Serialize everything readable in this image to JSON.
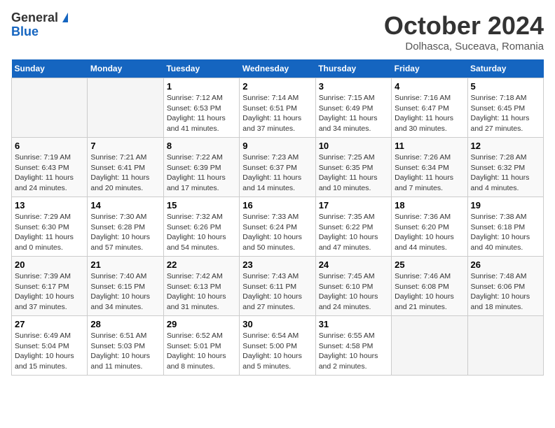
{
  "header": {
    "logo_general": "General",
    "logo_blue": "Blue",
    "month": "October 2024",
    "location": "Dolhasca, Suceava, Romania"
  },
  "weekdays": [
    "Sunday",
    "Monday",
    "Tuesday",
    "Wednesday",
    "Thursday",
    "Friday",
    "Saturday"
  ],
  "weeks": [
    [
      {
        "day": "",
        "detail": ""
      },
      {
        "day": "",
        "detail": ""
      },
      {
        "day": "1",
        "detail": "Sunrise: 7:12 AM\nSunset: 6:53 PM\nDaylight: 11 hours and 41 minutes."
      },
      {
        "day": "2",
        "detail": "Sunrise: 7:14 AM\nSunset: 6:51 PM\nDaylight: 11 hours and 37 minutes."
      },
      {
        "day": "3",
        "detail": "Sunrise: 7:15 AM\nSunset: 6:49 PM\nDaylight: 11 hours and 34 minutes."
      },
      {
        "day": "4",
        "detail": "Sunrise: 7:16 AM\nSunset: 6:47 PM\nDaylight: 11 hours and 30 minutes."
      },
      {
        "day": "5",
        "detail": "Sunrise: 7:18 AM\nSunset: 6:45 PM\nDaylight: 11 hours and 27 minutes."
      }
    ],
    [
      {
        "day": "6",
        "detail": "Sunrise: 7:19 AM\nSunset: 6:43 PM\nDaylight: 11 hours and 24 minutes."
      },
      {
        "day": "7",
        "detail": "Sunrise: 7:21 AM\nSunset: 6:41 PM\nDaylight: 11 hours and 20 minutes."
      },
      {
        "day": "8",
        "detail": "Sunrise: 7:22 AM\nSunset: 6:39 PM\nDaylight: 11 hours and 17 minutes."
      },
      {
        "day": "9",
        "detail": "Sunrise: 7:23 AM\nSunset: 6:37 PM\nDaylight: 11 hours and 14 minutes."
      },
      {
        "day": "10",
        "detail": "Sunrise: 7:25 AM\nSunset: 6:35 PM\nDaylight: 11 hours and 10 minutes."
      },
      {
        "day": "11",
        "detail": "Sunrise: 7:26 AM\nSunset: 6:34 PM\nDaylight: 11 hours and 7 minutes."
      },
      {
        "day": "12",
        "detail": "Sunrise: 7:28 AM\nSunset: 6:32 PM\nDaylight: 11 hours and 4 minutes."
      }
    ],
    [
      {
        "day": "13",
        "detail": "Sunrise: 7:29 AM\nSunset: 6:30 PM\nDaylight: 11 hours and 0 minutes."
      },
      {
        "day": "14",
        "detail": "Sunrise: 7:30 AM\nSunset: 6:28 PM\nDaylight: 10 hours and 57 minutes."
      },
      {
        "day": "15",
        "detail": "Sunrise: 7:32 AM\nSunset: 6:26 PM\nDaylight: 10 hours and 54 minutes."
      },
      {
        "day": "16",
        "detail": "Sunrise: 7:33 AM\nSunset: 6:24 PM\nDaylight: 10 hours and 50 minutes."
      },
      {
        "day": "17",
        "detail": "Sunrise: 7:35 AM\nSunset: 6:22 PM\nDaylight: 10 hours and 47 minutes."
      },
      {
        "day": "18",
        "detail": "Sunrise: 7:36 AM\nSunset: 6:20 PM\nDaylight: 10 hours and 44 minutes."
      },
      {
        "day": "19",
        "detail": "Sunrise: 7:38 AM\nSunset: 6:18 PM\nDaylight: 10 hours and 40 minutes."
      }
    ],
    [
      {
        "day": "20",
        "detail": "Sunrise: 7:39 AM\nSunset: 6:17 PM\nDaylight: 10 hours and 37 minutes."
      },
      {
        "day": "21",
        "detail": "Sunrise: 7:40 AM\nSunset: 6:15 PM\nDaylight: 10 hours and 34 minutes."
      },
      {
        "day": "22",
        "detail": "Sunrise: 7:42 AM\nSunset: 6:13 PM\nDaylight: 10 hours and 31 minutes."
      },
      {
        "day": "23",
        "detail": "Sunrise: 7:43 AM\nSunset: 6:11 PM\nDaylight: 10 hours and 27 minutes."
      },
      {
        "day": "24",
        "detail": "Sunrise: 7:45 AM\nSunset: 6:10 PM\nDaylight: 10 hours and 24 minutes."
      },
      {
        "day": "25",
        "detail": "Sunrise: 7:46 AM\nSunset: 6:08 PM\nDaylight: 10 hours and 21 minutes."
      },
      {
        "day": "26",
        "detail": "Sunrise: 7:48 AM\nSunset: 6:06 PM\nDaylight: 10 hours and 18 minutes."
      }
    ],
    [
      {
        "day": "27",
        "detail": "Sunrise: 6:49 AM\nSunset: 5:04 PM\nDaylight: 10 hours and 15 minutes."
      },
      {
        "day": "28",
        "detail": "Sunrise: 6:51 AM\nSunset: 5:03 PM\nDaylight: 10 hours and 11 minutes."
      },
      {
        "day": "29",
        "detail": "Sunrise: 6:52 AM\nSunset: 5:01 PM\nDaylight: 10 hours and 8 minutes."
      },
      {
        "day": "30",
        "detail": "Sunrise: 6:54 AM\nSunset: 5:00 PM\nDaylight: 10 hours and 5 minutes."
      },
      {
        "day": "31",
        "detail": "Sunrise: 6:55 AM\nSunset: 4:58 PM\nDaylight: 10 hours and 2 minutes."
      },
      {
        "day": "",
        "detail": ""
      },
      {
        "day": "",
        "detail": ""
      }
    ]
  ]
}
